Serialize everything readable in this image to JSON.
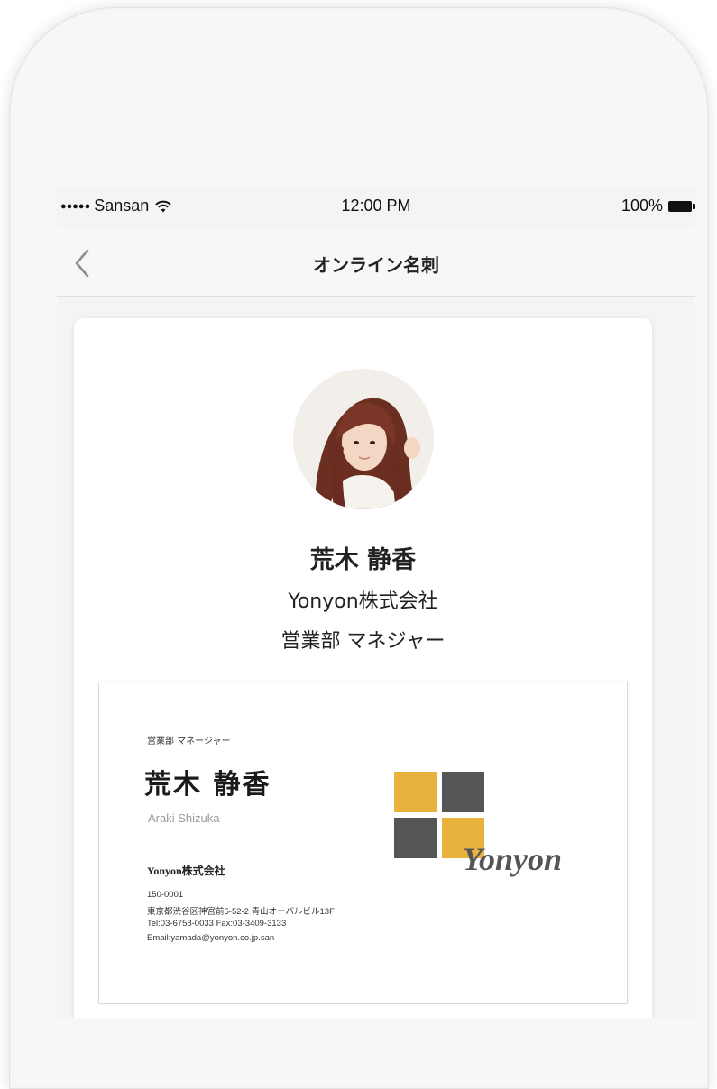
{
  "status_bar": {
    "signal_dots": "●●●●●",
    "carrier": "Sansan",
    "time": "12:00 PM",
    "battery": "100%"
  },
  "nav": {
    "title": "オンライン名刺"
  },
  "profile": {
    "name": "荒木 静香",
    "company": "Yonyon株式会社",
    "role": "営業部 マネジャー"
  },
  "business_card": {
    "role": "営業部 マネージャー",
    "name": "荒木 静香",
    "romaji": "Araki Shizuka",
    "company": "Yonyon株式会社",
    "postal": "150-0001",
    "address": "東京都渋谷区神宮前5-52-2 青山オーバルビル13F",
    "phone_fax": "Tel:03-6758-0033 Fax:03-3409-3133",
    "email": "Email:yamada@yonyon.co.jp.san",
    "logo_text": "Yonyon"
  },
  "colors": {
    "logo_yellow": "#e9b23d",
    "logo_gray": "#555555"
  },
  "icons": {
    "wifi": "wifi-icon",
    "battery": "battery-icon",
    "back": "chevron-left-icon"
  }
}
